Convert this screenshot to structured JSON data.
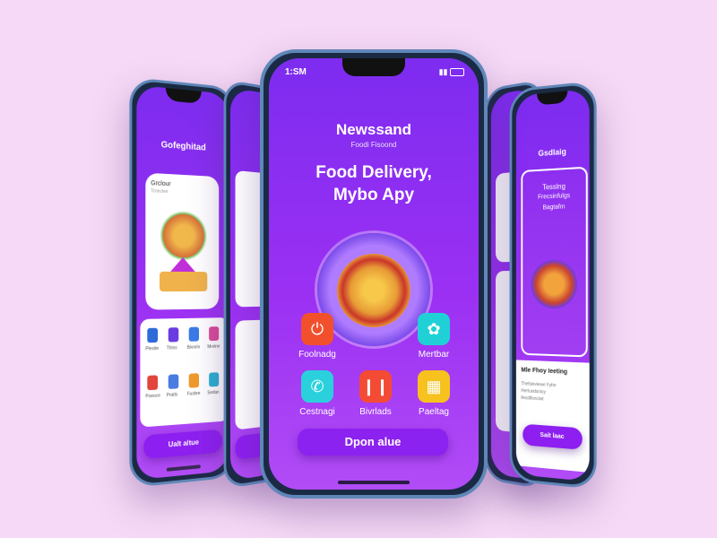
{
  "center_phone": {
    "status_time": "1:SM",
    "brand": "Newssand",
    "brand_sub": "Foodi Fisoond",
    "headline_line1": "Food Delivery,",
    "headline_line2": "Mybo Apy",
    "apps": [
      {
        "label": "Foolnadg",
        "icon": "power-icon",
        "color": "#f2502c"
      },
      {
        "label": "Mertbar",
        "icon": "flower-icon",
        "color": "#1fd1d6"
      },
      {
        "label": "Cestnagi",
        "icon": "phone-icon",
        "color": "#2ad1dc"
      },
      {
        "label": "Bivrlads",
        "icon": "fork-icon",
        "color": "#f34b34"
      },
      {
        "label": "Paeltag",
        "icon": "grid-icon",
        "color": "#f7c21d"
      }
    ],
    "cta": "Dpon alue"
  },
  "left_phone": {
    "title": "Gofeghitad",
    "card_title": "Grclour",
    "card_sub": "Tcneclee",
    "grid_labels": [
      "Plesite",
      "Thlns",
      "Bivnrin",
      "Mrelne",
      "Poeoce",
      "Pratls",
      "Fusbre",
      "Sedan"
    ],
    "cta": "Ualt altue"
  },
  "right_phone": {
    "title": "Gsdlaig",
    "card_title_line1": "Tesslng",
    "card_title_line2": "Frecsinfulgs",
    "card_title_line3": "Bagtafm",
    "section_title": "Mle Fhoy Ieeting",
    "body_lines": [
      "Thefsleviewe Fyfor",
      "Hertuodsoluy",
      "llesdlfonciwt"
    ],
    "cta": "Sait laac"
  }
}
